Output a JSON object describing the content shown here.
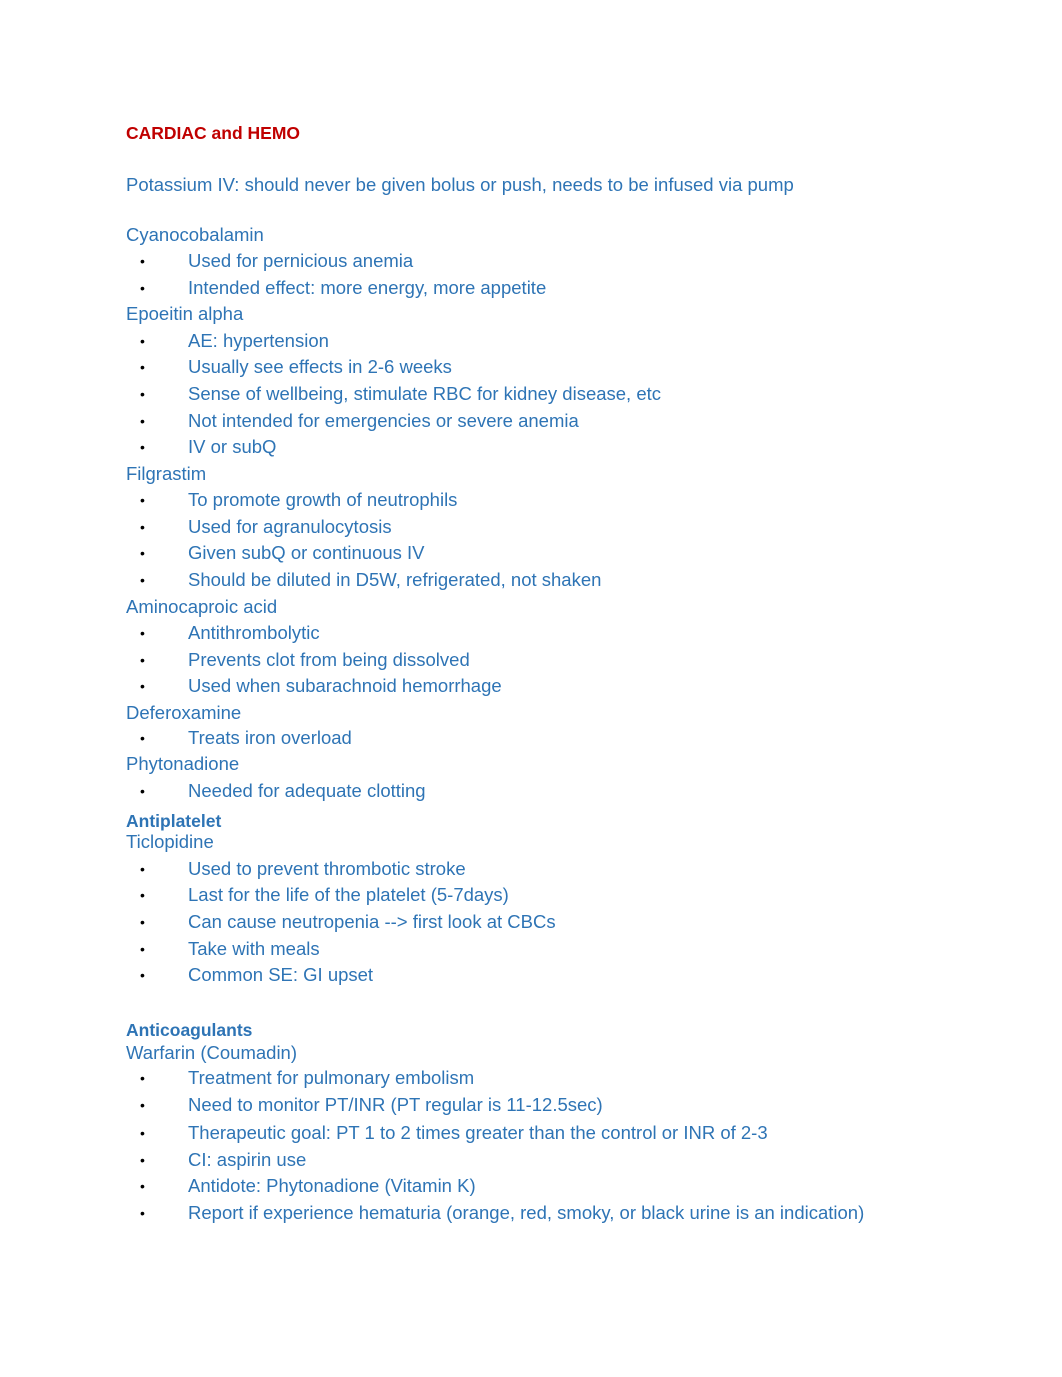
{
  "document": {
    "title": "CARDIAC and HEMO",
    "potassium_note": "Potassium IV: should never be given bolus or push, needs to be infused via pump",
    "bullet_glyph": "•",
    "colors": {
      "title": "#C00000",
      "body": "#2E74B5",
      "bullet": "#000000"
    },
    "drugs_hemo": [
      {
        "name": "Cyanocobalamin",
        "points": [
          "Used for pernicious anemia",
          "Intended effect: more energy, more appetite"
        ]
      },
      {
        "name": "Epoeitin alpha",
        "points": [
          "AE: hypertension",
          "Usually see effects in 2-6 weeks",
          "Sense of wellbeing, stimulate RBC for kidney disease, etc",
          "Not intended for emergencies or severe anemia",
          "IV or subQ"
        ]
      },
      {
        "name": "Filgrastim",
        "points": [
          "To promote growth of neutrophils",
          "Used for agranulocytosis",
          "Given subQ or continuous IV",
          "Should be diluted in D5W, refrigerated, not shaken"
        ]
      },
      {
        "name": "Aminocaproic acid",
        "points": [
          "Antithrombolytic",
          "Prevents clot from being dissolved",
          "Used when subarachnoid hemorrhage"
        ]
      },
      {
        "name": "Deferoxamine",
        "points": [
          "Treats iron overload"
        ]
      },
      {
        "name": "Phytonadione",
        "points": [
          "Needed for adequate clotting"
        ]
      }
    ],
    "antiplatelet": {
      "heading": "Antiplatelet",
      "drug": {
        "name": "Ticlopidine",
        "points": [
          "Used to prevent thrombotic stroke",
          "Last for the life of the platelet (5-7days)",
          "Can cause neutropenia --> first look at CBCs",
          "Take with meals",
          "Common SE: GI upset"
        ]
      }
    },
    "anticoagulants": {
      "heading": "Anticoagulants",
      "drug": {
        "name": "Warfarin (Coumadin)",
        "points": [
          "Treatment for pulmonary embolism",
          "Need to monitor PT/INR (PT regular is 11-12.5sec)",
          "Therapeutic goal: PT 1 to 2 times greater than the control or INR of 2-3",
          "CI: aspirin use",
          "Antidote: Phytonadione (Vitamin K)",
          "Report if experience hematuria (orange, red, smoky, or black urine is an indication)"
        ]
      }
    }
  }
}
